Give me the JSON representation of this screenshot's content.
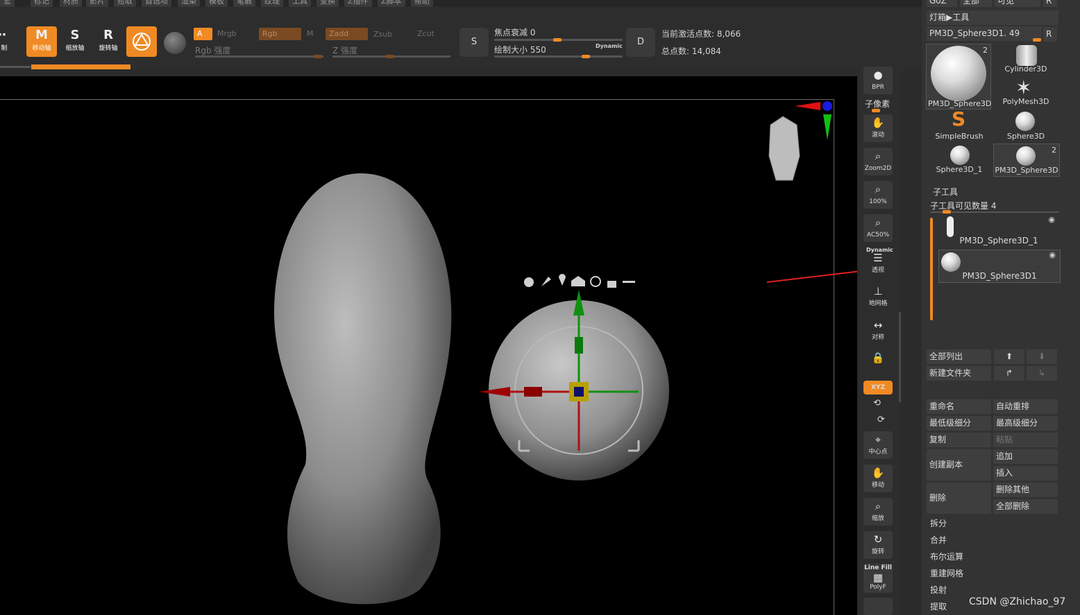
{
  "menu": [
    "宏",
    "标记",
    "材质",
    "影片",
    "拾取",
    "首选项",
    "渲染",
    "模板",
    "笔触",
    "纹理",
    "工具",
    "变换",
    "Z插件",
    "Z脚本",
    "帮助"
  ],
  "toolbar": {
    "draw_label": "绘 制",
    "move_label": "移动轴",
    "move_key": "M",
    "scale_label": "缩放轴",
    "scale_key": "S",
    "rotate_label": "旋转轴",
    "rotate_key": "R",
    "a_label": "A",
    "mrgb_label": "Mrgb",
    "rgb_label": "Rgb",
    "m_label": "M",
    "zadd_label": "Zadd",
    "zsub_label": "Zsub",
    "zcut_label": "Zcut",
    "rgb_intensity_label": "Rgb 强度",
    "z_intensity_label": "Z 强度",
    "focal_shift_label": "焦点衰减 0",
    "draw_size_label": "绘制大小 550",
    "dynamic_label": "Dynamic",
    "s_btn": "S",
    "d_btn": "D",
    "active_points": "当前激活点数: 8,066",
    "total_points": "总点数: 14,084"
  },
  "shelf": [
    {
      "icon": "bpr-icon",
      "label": "BPR"
    },
    {
      "icon": "",
      "label": "子像素"
    },
    {
      "icon": "scroll-icon",
      "label": "滚动"
    },
    {
      "icon": "zoom2d-icon",
      "label": "Zoom2D"
    },
    {
      "icon": "zoom100-icon",
      "label": "100%"
    },
    {
      "icon": "ac50-icon",
      "label": "AC50%"
    },
    {
      "icon": "perspective-icon",
      "label": "透视"
    },
    {
      "icon": "floor-icon",
      "label": "地网格"
    },
    {
      "icon": "symmetry-icon",
      "label": "对称"
    },
    {
      "icon": "lock-camera-icon",
      "label": ""
    },
    {
      "icon": "xyz-icon",
      "label": "XYZ"
    },
    {
      "icon": "center-icon",
      "label": "中心点"
    },
    {
      "icon": "move-icon",
      "label": "移动"
    },
    {
      "icon": "scale-icon",
      "label": "缩放"
    },
    {
      "icon": "rotate-icon",
      "label": "旋转"
    },
    {
      "icon": "polyf-icon",
      "label": "PolyF"
    },
    {
      "icon": "",
      "label": "Line Fill"
    },
    {
      "icon": "",
      "label": "Dynamic"
    }
  ],
  "panel": {
    "top_buttons": [
      "GoZ",
      "全部",
      "可见",
      "R"
    ],
    "lightbox_tools": "灯箱▶工具",
    "current_tool": "PM3D_Sphere3D1. 49",
    "r_button": "R",
    "tools": [
      {
        "name": "PM3D_Sphere3D",
        "badge": "2"
      },
      {
        "name": "Cylinder3D",
        "badge": ""
      },
      {
        "name": "PolyMesh3D",
        "badge": ""
      },
      {
        "name": "SimpleBrush",
        "badge": ""
      },
      {
        "name": "Sphere3D",
        "badge": ""
      },
      {
        "name": "Sphere3D_1",
        "badge": ""
      },
      {
        "name": "PM3D_Sphere3D",
        "badge": "2"
      }
    ],
    "subtool_title": "子工具",
    "visible_count": "子工具可见数量 4",
    "subtools": [
      "PM3D_Sphere3D_1",
      "PM3D_Sphere3D1"
    ],
    "list_all": "全部列出",
    "new_folder": "新建文件夹",
    "rename": "重命名",
    "auto_reorder": "自动重排",
    "lowest_res": "最低级细分",
    "highest_res": "最高级细分",
    "copy": "复制",
    "paste": "粘贴",
    "duplicate": "创建副本",
    "append": "追加",
    "insert": "插入",
    "delete": "删除",
    "delete_other": "删除其他",
    "delete_all": "全部删除",
    "split": "拆分",
    "merge": "合并",
    "boolean": "布尔运算",
    "remesh": "重建网格",
    "project": "投射",
    "extract": "提取"
  },
  "watermark": "CSDN @Zhichao_97",
  "colors": {
    "accent": "#f08a24",
    "x_axis": "#d01010",
    "y_axis": "#109010",
    "z_axis": "#1a1ae0"
  }
}
